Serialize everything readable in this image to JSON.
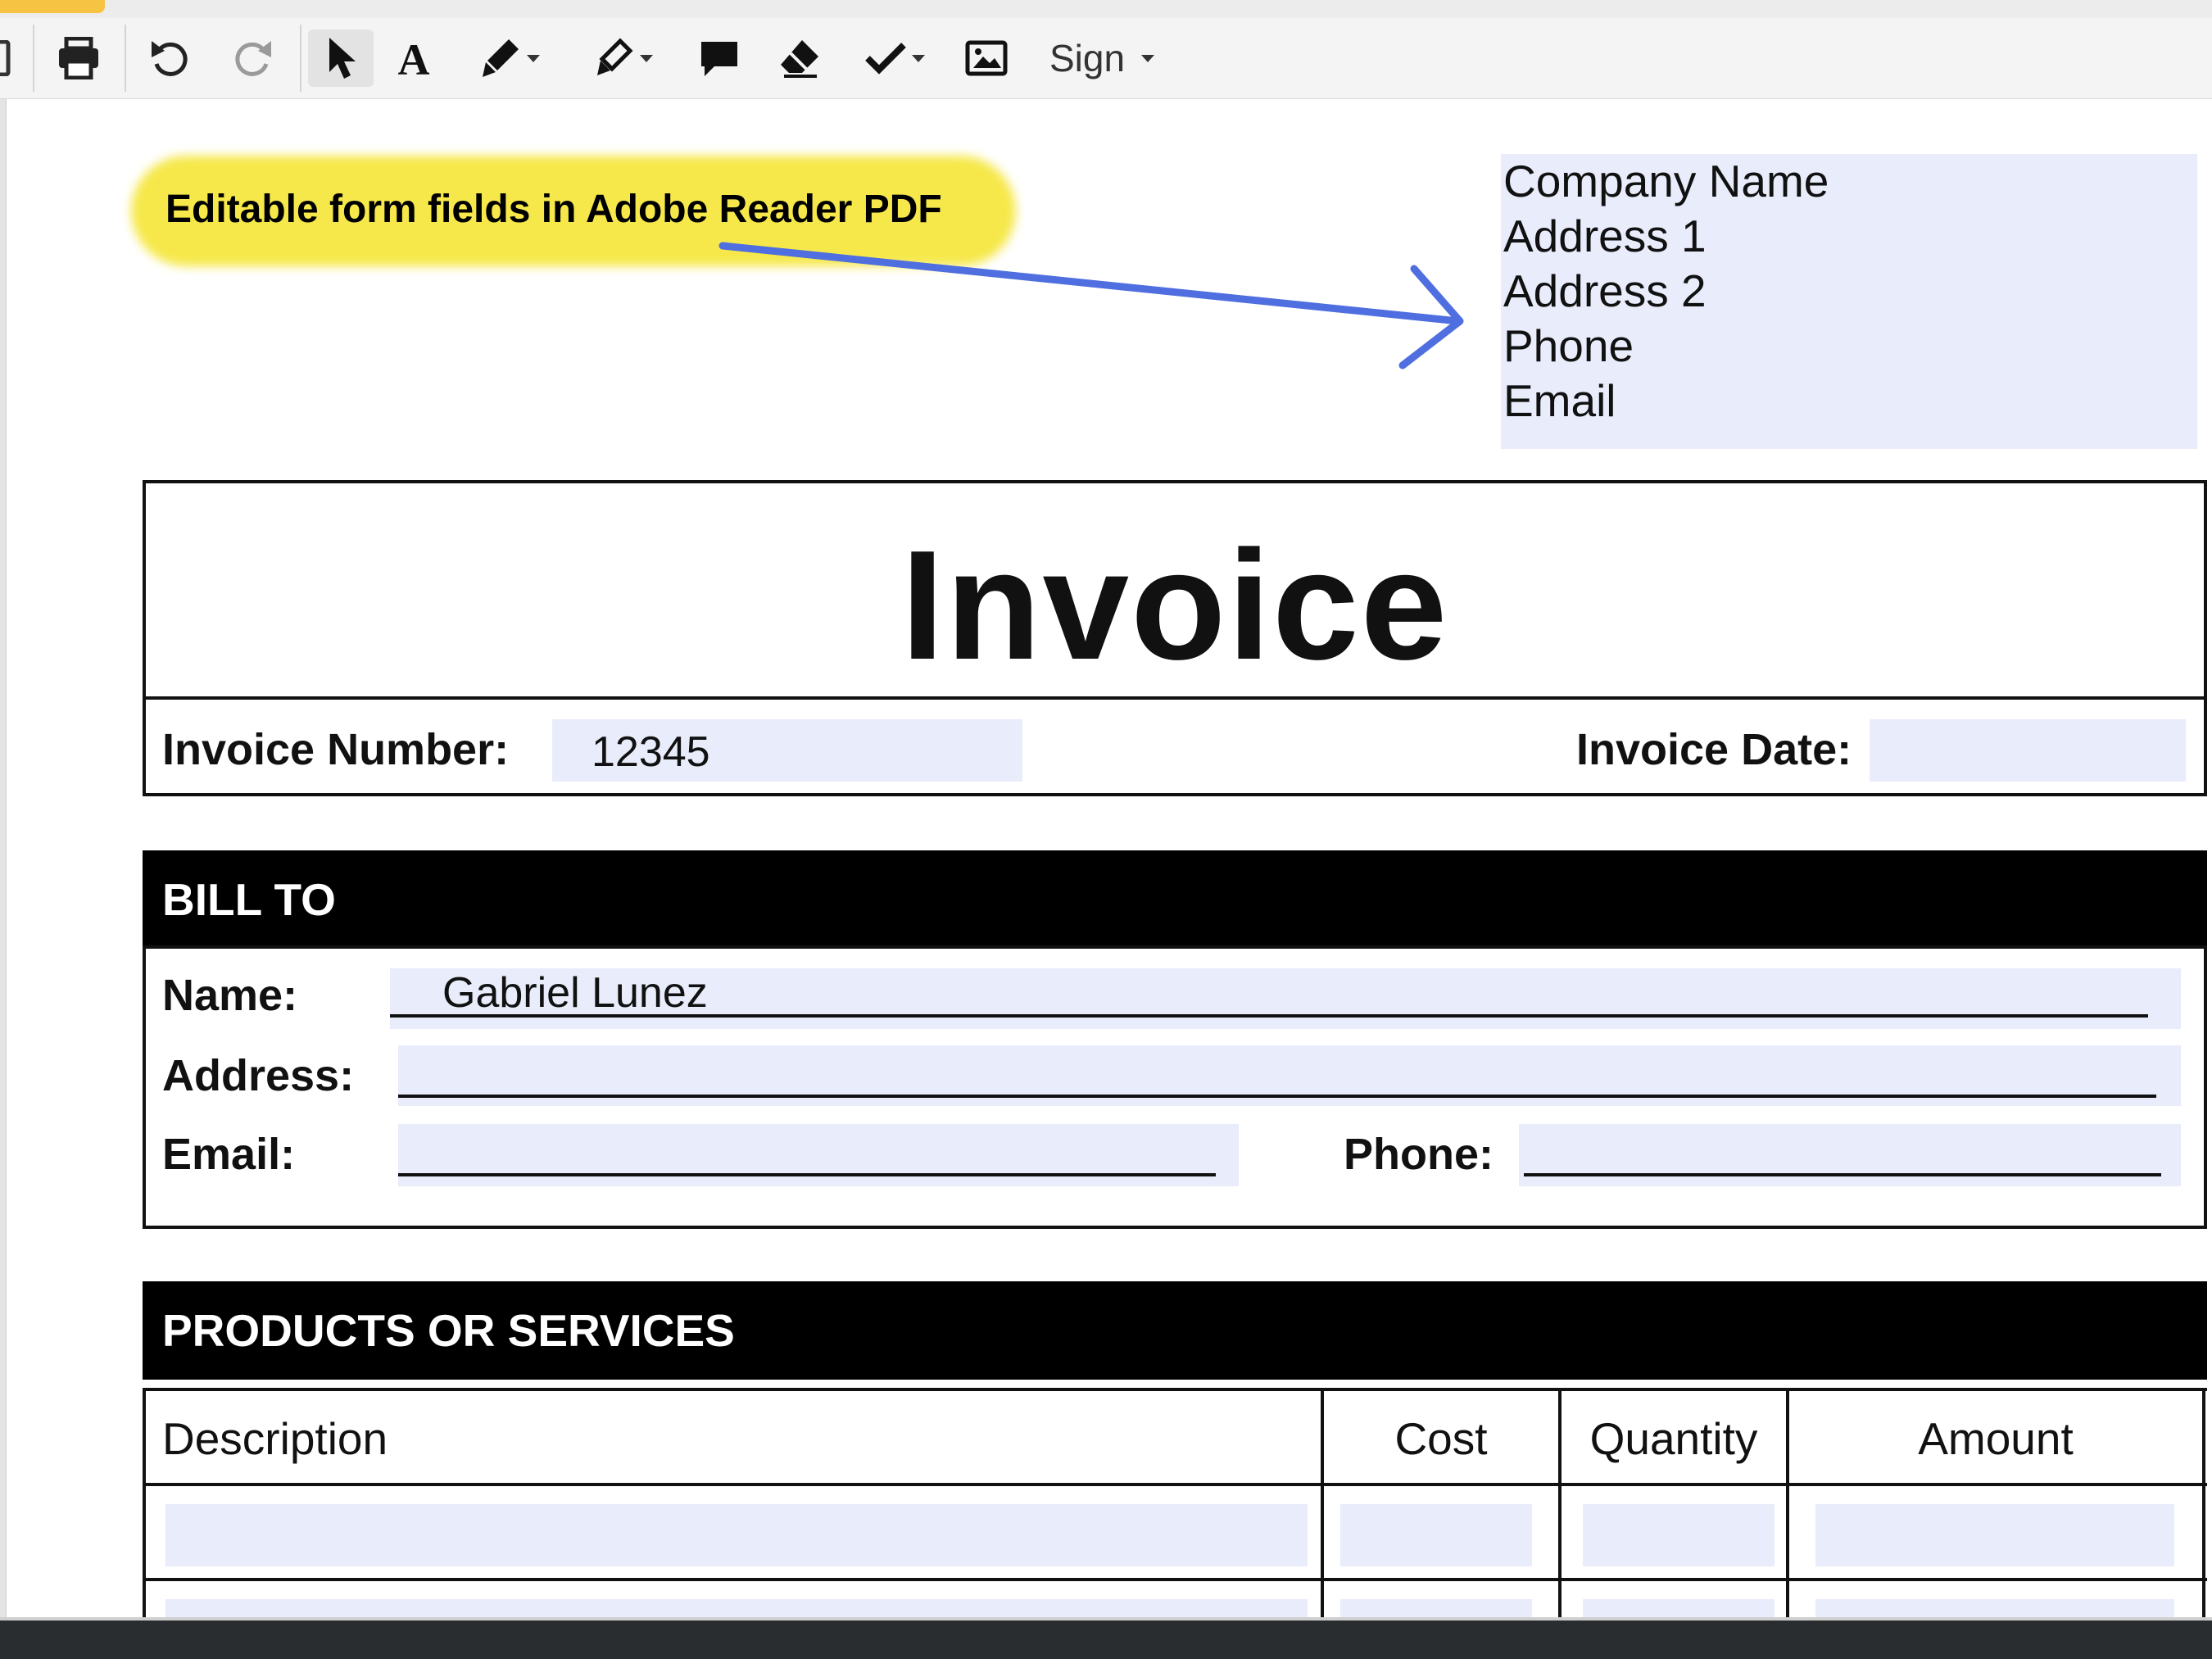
{
  "toolbar": {
    "sign_label": "Sign",
    "tools": [
      {
        "icon": "print-icon"
      },
      {
        "icon": "undo-icon"
      },
      {
        "icon": "redo-icon"
      },
      {
        "icon": "select-pointer-icon"
      },
      {
        "icon": "text-tool-icon"
      },
      {
        "icon": "pen-icon"
      },
      {
        "icon": "highlighter-icon"
      },
      {
        "icon": "comment-icon"
      },
      {
        "icon": "eraser-icon"
      },
      {
        "icon": "checkmark-icon"
      },
      {
        "icon": "image-icon"
      }
    ]
  },
  "annotation": {
    "text": "Editable form fields in Adobe Reader PDF",
    "highlight_color": "#f6e84a",
    "arrow_color": "#4f6fe0"
  },
  "company": {
    "lines": [
      "Company Name",
      "Address 1",
      "Address 2",
      "Phone",
      "Email"
    ]
  },
  "invoice": {
    "title": "Invoice",
    "number_label": "Invoice Number:",
    "number_value": "12345",
    "date_label": "Invoice Date:",
    "date_value": ""
  },
  "bill_to": {
    "header": "BILL TO",
    "name_label": "Name:",
    "name_value": "Gabriel Lunez",
    "address_label": "Address:",
    "address_value": "",
    "email_label": "Email:",
    "email_value": "",
    "phone_label": "Phone:",
    "phone_value": ""
  },
  "products": {
    "header": "PRODUCTS OR SERVICES",
    "columns": [
      "Description",
      "Cost",
      "Quantity",
      "Amount"
    ]
  },
  "colors": {
    "field_fill": "#e8ecfb",
    "header_fill": "#000000"
  }
}
